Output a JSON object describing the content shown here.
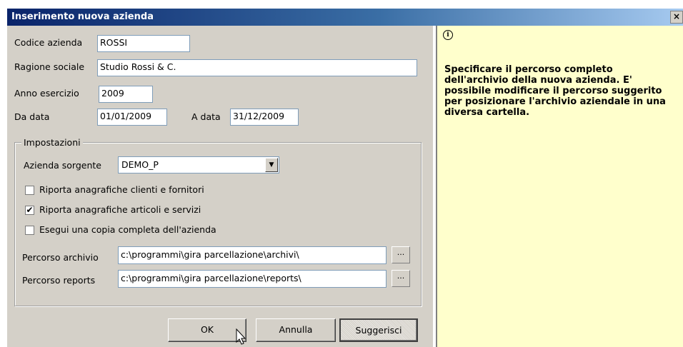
{
  "window": {
    "title": "Inserimento nuova azienda",
    "close_label": "×"
  },
  "fields": {
    "codice_label": "Codice azienda",
    "codice_value": "ROSSI",
    "ragione_label": "Ragione sociale",
    "ragione_value": "Studio Rossi & C.",
    "anno_label": "Anno esercizio",
    "anno_value": "2009",
    "da_label": "Da data",
    "da_value": "01/01/2009",
    "a_label": "A data",
    "a_value": "31/12/2009"
  },
  "settings": {
    "group_label": "Impostazioni",
    "sorgente_label": "Azienda sorgente",
    "sorgente_value": "DEMO_P",
    "checkboxes": [
      {
        "label": "Riporta anagrafiche clienti e fornitori",
        "checked": false,
        "mark": ""
      },
      {
        "label": "Riporta anagrafiche articoli e servizi",
        "checked": true,
        "mark": "✔"
      },
      {
        "label": "Esegui una copia completa dell'azienda",
        "checked": false,
        "mark": ""
      }
    ],
    "archivio_label": "Percorso archivio",
    "archivio_value": "c:\\programmi\\gira parcellazione\\archivi\\",
    "reports_label": "Percorso reports",
    "reports_value": "c:\\programmi\\gira parcellazione\\reports\\",
    "browse_label": "..."
  },
  "buttons": {
    "ok": "OK",
    "annulla": "Annulla",
    "suggerisci": "Suggerisci"
  },
  "help": {
    "icon": "i",
    "text": "Specificare il percorso completo dell'archivio della nuova azienda. E' possibile modificare il percorso suggerito per posizionare l'archivio aziendale in una diversa cartella."
  },
  "colors": {
    "title_start": "#0a246a",
    "dialog_bg": "#d4d0c8",
    "help_bg": "#ffffcc"
  }
}
